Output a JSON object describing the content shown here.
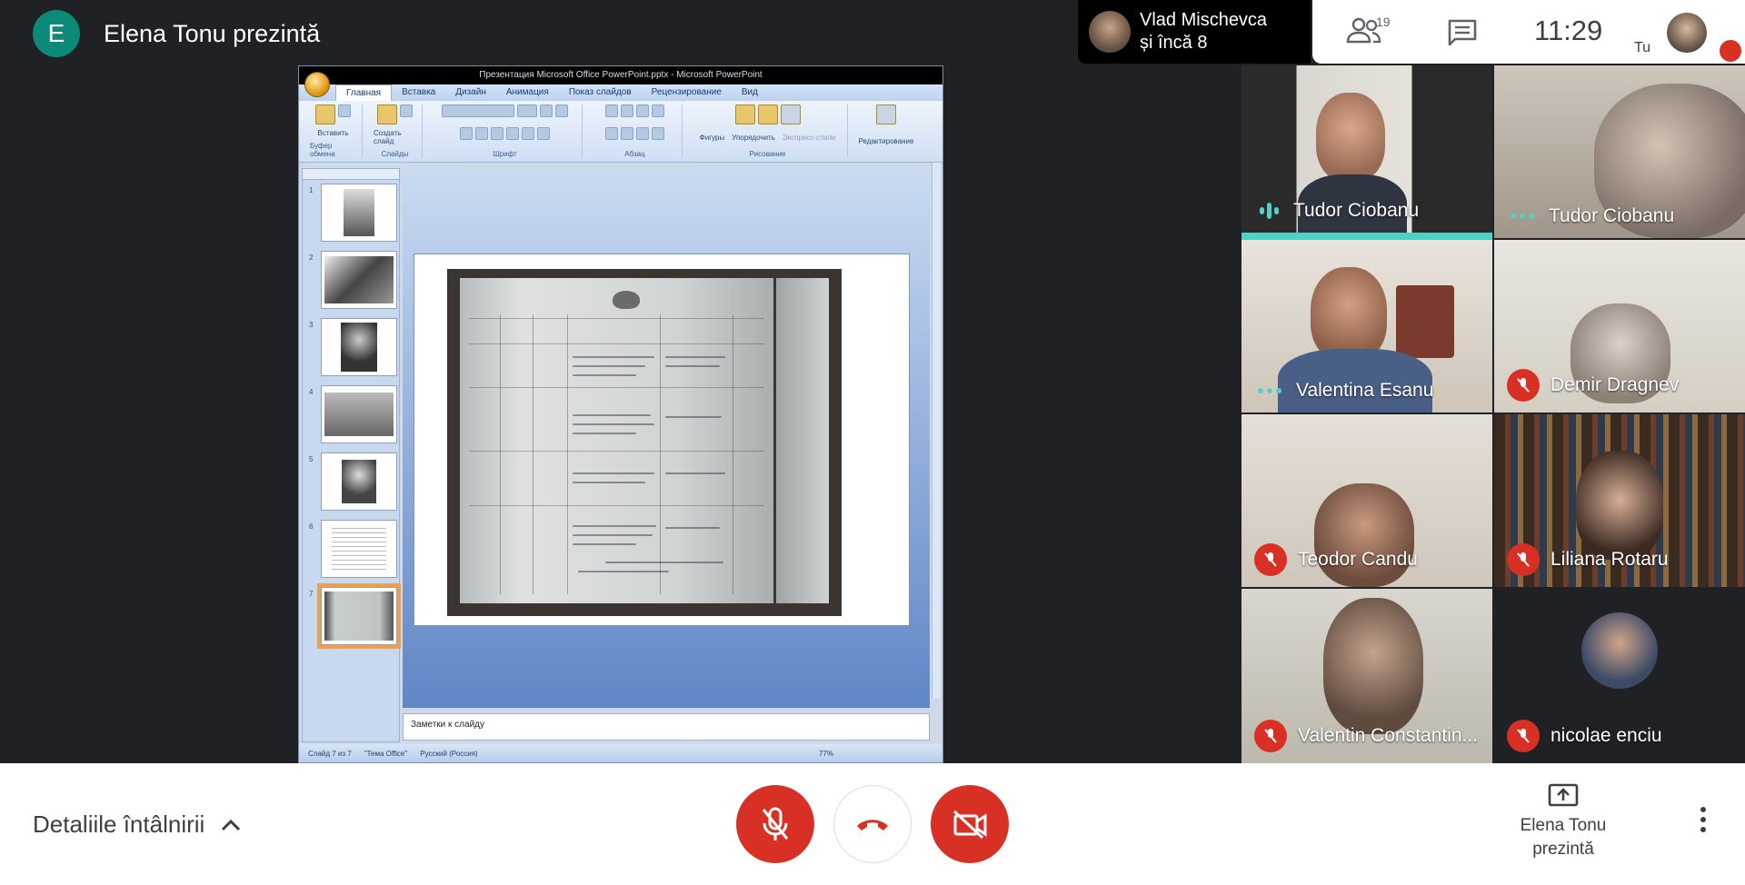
{
  "presenter": {
    "initial": "E",
    "title": "Elena Tonu prezintă",
    "initial_color": "#0b8a7a"
  },
  "top_bar": {
    "others_name": "Vlad Mischevca",
    "others_more": "și încă 8",
    "people_count": "19",
    "clock": "11:29",
    "self_label": "Tu"
  },
  "powerpoint": {
    "window_title": "Презентация Microsoft Office PowerPoint.pptx - Microsoft PowerPoint",
    "tabs": [
      "Главная",
      "Вставка",
      "Дизайн",
      "Анимация",
      "Показ слайдов",
      "Рецензирование",
      "Вид"
    ],
    "groups": [
      {
        "label": "Буфер обмена",
        "button": "Вставить"
      },
      {
        "label": "Слайды",
        "button": "Создать слайд"
      },
      {
        "label": "Шрифт",
        "button": ""
      },
      {
        "label": "Абзац",
        "button": ""
      },
      {
        "label": "Рисование",
        "button": "Фигуры"
      },
      {
        "label": "",
        "button": "Редактирование"
      }
    ],
    "extra_buttons": [
      "Упорядочить",
      "Экспресс-стили"
    ],
    "thumbnails": [
      "1",
      "2",
      "3",
      "4",
      "5",
      "6",
      "7"
    ],
    "notes_text": "Заметки к слайду",
    "status": {
      "slide": "Слайд 7 из 7",
      "theme": "\"Тема Office\"",
      "language": "Русский (Россия)",
      "zoom": "77%"
    }
  },
  "participants": [
    {
      "name": "Tudor Ciobanu",
      "status": "speaking"
    },
    {
      "name": "Tudor Ciobanu",
      "status": "dots"
    },
    {
      "name": "Valentina Esanu",
      "status": "dots"
    },
    {
      "name": "Demir Dragnev",
      "status": "muted"
    },
    {
      "name": "Teodor Candu",
      "status": "muted"
    },
    {
      "name": "Liliana Rotaru",
      "status": "muted"
    },
    {
      "name": "Valentin Constantin...",
      "status": "muted"
    },
    {
      "name": "nicolae enciu",
      "status": "muted"
    }
  ],
  "bottom_bar": {
    "details_label": "Detaliile întâlnirii",
    "present_label_1": "Elena Tonu",
    "present_label_2": "prezintă"
  },
  "colors": {
    "meet_red": "#d93025",
    "speaking_accent": "#4fd1c5",
    "background": "#202124"
  }
}
